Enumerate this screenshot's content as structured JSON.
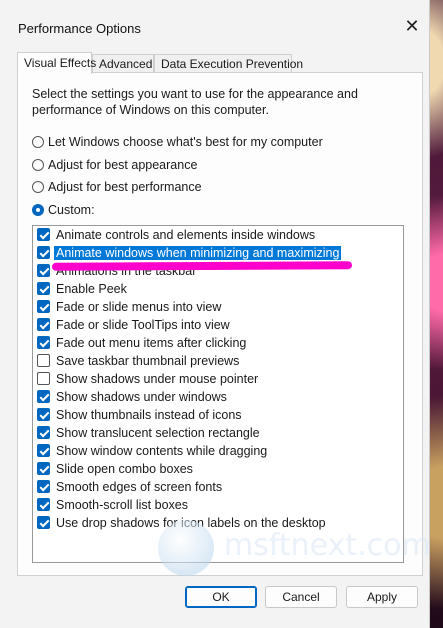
{
  "window": {
    "title": "Performance Options",
    "close_glyph": "✕"
  },
  "tabs": [
    {
      "label": "Visual Effects",
      "active": true
    },
    {
      "label": "Advanced",
      "active": false
    },
    {
      "label": "Data Execution Prevention",
      "active": false
    }
  ],
  "description": "Select the settings you want to use for the appearance and performance of Windows on this computer.",
  "radios": [
    {
      "label": "Let Windows choose what's best for my computer",
      "checked": false
    },
    {
      "label": "Adjust for best appearance",
      "checked": false
    },
    {
      "label": "Adjust for best performance",
      "checked": false
    },
    {
      "label": "Custom:",
      "checked": true
    }
  ],
  "effects": [
    {
      "label": "Animate controls and elements inside windows",
      "checked": true
    },
    {
      "label": "Animate windows when minimizing and maximizing",
      "checked": true,
      "selected": true
    },
    {
      "label": "Animations in the taskbar",
      "checked": true
    },
    {
      "label": "Enable Peek",
      "checked": true
    },
    {
      "label": "Fade or slide menus into view",
      "checked": true
    },
    {
      "label": "Fade or slide ToolTips into view",
      "checked": true
    },
    {
      "label": "Fade out menu items after clicking",
      "checked": true
    },
    {
      "label": "Save taskbar thumbnail previews",
      "checked": false
    },
    {
      "label": "Show shadows under mouse pointer",
      "checked": false
    },
    {
      "label": "Show shadows under windows",
      "checked": true
    },
    {
      "label": "Show thumbnails instead of icons",
      "checked": true
    },
    {
      "label": "Show translucent selection rectangle",
      "checked": true
    },
    {
      "label": "Show window contents while dragging",
      "checked": true
    },
    {
      "label": "Slide open combo boxes",
      "checked": true
    },
    {
      "label": "Smooth edges of screen fonts",
      "checked": true
    },
    {
      "label": "Smooth-scroll list boxes",
      "checked": true
    },
    {
      "label": "Use drop shadows for icon labels on the desktop",
      "checked": true
    }
  ],
  "buttons": {
    "ok": "OK",
    "cancel": "Cancel",
    "apply": "Apply"
  },
  "watermark": "msftnext.com",
  "colors": {
    "accent": "#0067c0",
    "selection": "#0078d7",
    "marker": "#ff00cc"
  }
}
